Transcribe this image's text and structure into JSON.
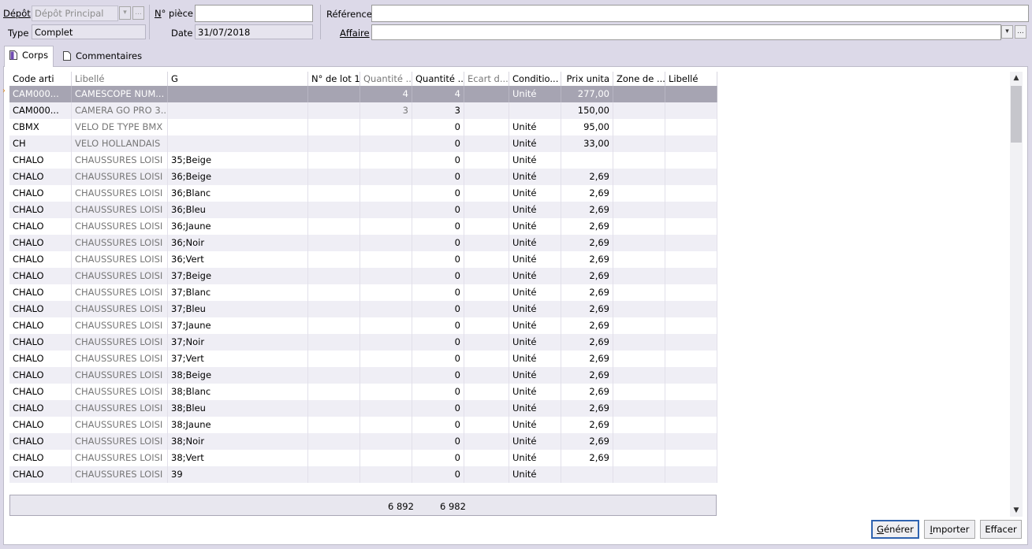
{
  "header": {
    "depot_label": "Dépôt",
    "depot_value": "Dépôt Principal",
    "type_label": "Type",
    "type_value": "Complet",
    "piece_label_first": "N",
    "piece_label_rest": "° pièce",
    "piece_value": "",
    "date_label": "Date",
    "date_value": "31/07/2018",
    "reference_label": "Référence",
    "reference_value": "",
    "affaire_label": "Affaire",
    "affaire_value": "",
    "ellipsis": "...",
    "dropdown_arrow": "▾"
  },
  "tabs": [
    {
      "label": "Corps",
      "active": true
    },
    {
      "label": "Commentaires",
      "active": false
    }
  ],
  "grid": {
    "columns": [
      "Code arti",
      "Libellé",
      "G",
      "N° de lot 1",
      "Quantité ...",
      "Quantité ...",
      "Ecart d...",
      "Conditio...",
      "Prix unita",
      "Zone de ...",
      "Libellé"
    ],
    "rows": [
      [
        "CAM000...",
        "CAMESCOPE NUM...",
        "",
        "",
        "4",
        "4",
        "",
        "Unité",
        "277,00",
        "",
        ""
      ],
      [
        "CAM000...",
        "CAMERA GO PRO 3...",
        "",
        "",
        "3",
        "3",
        "",
        "",
        "150,00",
        "",
        ""
      ],
      [
        "CBMX",
        "VELO DE TYPE BMX",
        "",
        "",
        "",
        "0",
        "",
        "Unité",
        "95,00",
        "",
        ""
      ],
      [
        "CH",
        "VELO HOLLANDAIS",
        "",
        "",
        "",
        "0",
        "",
        "Unité",
        "33,00",
        "",
        ""
      ],
      [
        "CHALO",
        "CHAUSSURES LOISI",
        "35;Beige",
        "",
        "",
        "0",
        "",
        "Unité",
        "",
        "",
        ""
      ],
      [
        "CHALO",
        "CHAUSSURES LOISI",
        "36;Beige",
        "",
        "",
        "0",
        "",
        "Unité",
        "2,69",
        "",
        ""
      ],
      [
        "CHALO",
        "CHAUSSURES LOISI",
        "36;Blanc",
        "",
        "",
        "0",
        "",
        "Unité",
        "2,69",
        "",
        ""
      ],
      [
        "CHALO",
        "CHAUSSURES LOISI",
        "36;Bleu",
        "",
        "",
        "0",
        "",
        "Unité",
        "2,69",
        "",
        ""
      ],
      [
        "CHALO",
        "CHAUSSURES LOISI",
        "36;Jaune",
        "",
        "",
        "0",
        "",
        "Unité",
        "2,69",
        "",
        ""
      ],
      [
        "CHALO",
        "CHAUSSURES LOISI",
        "36;Noir",
        "",
        "",
        "0",
        "",
        "Unité",
        "2,69",
        "",
        ""
      ],
      [
        "CHALO",
        "CHAUSSURES LOISI",
        "36;Vert",
        "",
        "",
        "0",
        "",
        "Unité",
        "2,69",
        "",
        ""
      ],
      [
        "CHALO",
        "CHAUSSURES LOISI",
        "37;Beige",
        "",
        "",
        "0",
        "",
        "Unité",
        "2,69",
        "",
        ""
      ],
      [
        "CHALO",
        "CHAUSSURES LOISI",
        "37;Blanc",
        "",
        "",
        "0",
        "",
        "Unité",
        "2,69",
        "",
        ""
      ],
      [
        "CHALO",
        "CHAUSSURES LOISI",
        "37;Bleu",
        "",
        "",
        "0",
        "",
        "Unité",
        "2,69",
        "",
        ""
      ],
      [
        "CHALO",
        "CHAUSSURES LOISI",
        "37;Jaune",
        "",
        "",
        "0",
        "",
        "Unité",
        "2,69",
        "",
        ""
      ],
      [
        "CHALO",
        "CHAUSSURES LOISI",
        "37;Noir",
        "",
        "",
        "0",
        "",
        "Unité",
        "2,69",
        "",
        ""
      ],
      [
        "CHALO",
        "CHAUSSURES LOISI",
        "37;Vert",
        "",
        "",
        "0",
        "",
        "Unité",
        "2,69",
        "",
        ""
      ],
      [
        "CHALO",
        "CHAUSSURES LOISI",
        "38;Beige",
        "",
        "",
        "0",
        "",
        "Unité",
        "2,69",
        "",
        ""
      ],
      [
        "CHALO",
        "CHAUSSURES LOISI",
        "38;Blanc",
        "",
        "",
        "0",
        "",
        "Unité",
        "2,69",
        "",
        ""
      ],
      [
        "CHALO",
        "CHAUSSURES LOISI",
        "38;Bleu",
        "",
        "",
        "0",
        "",
        "Unité",
        "2,69",
        "",
        ""
      ],
      [
        "CHALO",
        "CHAUSSURES LOISI",
        "38;Jaune",
        "",
        "",
        "0",
        "",
        "Unité",
        "2,69",
        "",
        ""
      ],
      [
        "CHALO",
        "CHAUSSURES LOISI",
        "38;Noir",
        "",
        "",
        "0",
        "",
        "Unité",
        "2,69",
        "",
        ""
      ],
      [
        "CHALO",
        "CHAUSSURES LOISI",
        "38;Vert",
        "",
        "",
        "0",
        "",
        "Unité",
        "2,69",
        "",
        ""
      ],
      [
        "CHALO",
        "CHAUSSURES LOISI",
        "39",
        "",
        "",
        "0",
        "",
        "Unité",
        "",
        "",
        ""
      ]
    ],
    "selected_row": 0,
    "row_marker": "›"
  },
  "totals": {
    "qty1": "6 892",
    "qty2": "6 982"
  },
  "scrollbar": {
    "up": "▲",
    "down": "▼"
  },
  "buttons": {
    "generer_first": "G",
    "generer_rest": "énérer",
    "importer_first": "I",
    "importer_rest": "mporter",
    "effacer": "Effacer"
  },
  "colors": {
    "selected_row": "#a6a4b2",
    "window_bg": "#dcd9e8",
    "default_button_border": "#2f63b0",
    "row_marker": "#e08a1e"
  }
}
